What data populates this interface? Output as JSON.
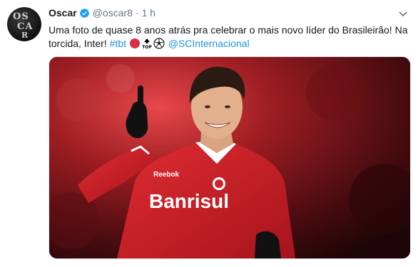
{
  "tweet": {
    "name": "Oscar",
    "handle": "@oscar8",
    "separator": "·",
    "time": "1 h",
    "text_line1": "Uma foto de quase 8 anos atrás pra celebrar o mais novo líder do Brasileirão! Na",
    "text_line2_prefix": "torcida, Inter! ",
    "hashtag": "#tbt",
    "mention": "@SCInternacional"
  },
  "photo": {
    "shirt_sponsor": "Banrisul",
    "shirt_brand": "Reebok"
  },
  "icons": {
    "verified": "verified-badge-icon",
    "chevron": "chevron-down-icon",
    "emoji1": "red-circle-emoji",
    "emoji2": "top-arrow-emoji",
    "emoji3": "soccer-ball-emoji"
  },
  "colors": {
    "link": "#1b95e0",
    "muted": "#657786",
    "text": "#14171a",
    "jersey": "#d3212a"
  }
}
